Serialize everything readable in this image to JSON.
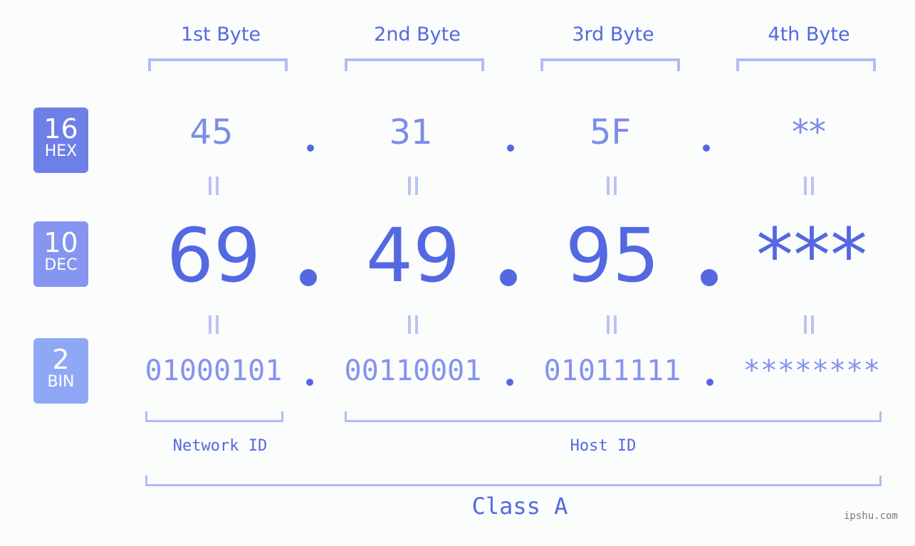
{
  "headers": [
    "1st Byte",
    "2nd Byte",
    "3rd Byte",
    "4th Byte"
  ],
  "badges": {
    "hex": {
      "num": "16",
      "label": "HEX",
      "color": "#6f7fe8"
    },
    "dec": {
      "num": "10",
      "label": "DEC",
      "color": "#8595f0"
    },
    "bin": {
      "num": "2",
      "label": "BIN",
      "color": "#8fa8f6"
    }
  },
  "hex_values": [
    "45",
    "31",
    "5F",
    "**"
  ],
  "dec_values": [
    "69",
    "49",
    "95",
    "***"
  ],
  "bin_values": [
    "01000101",
    "00110001",
    "01011111",
    "********"
  ],
  "network_label": "Network ID",
  "host_label": "Host ID",
  "class_label": "Class A",
  "watermark": "ipshu.com",
  "colors": {
    "accent": "#5468e2",
    "bracket": "#b1bcf6",
    "background": "#fbfcfc"
  }
}
